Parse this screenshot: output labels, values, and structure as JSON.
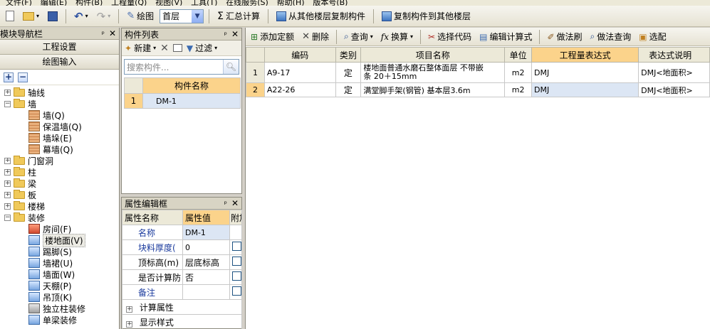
{
  "menubar": {
    "items": [
      "文件(F)",
      "编辑(E)",
      "构件(B)",
      "工程量(Q)",
      "视图(V)",
      "工具(T)",
      "在线服务(S)",
      "帮助(H)",
      "版本号(B)"
    ]
  },
  "toolbar": {
    "draw_label": "绘图",
    "floor_value": "首层",
    "sum_label": "汇总计算",
    "copy_from_label": "从其他楼层复制构件",
    "copy_to_label": "复制构件到其他楼层"
  },
  "nav": {
    "title": "模块导航栏",
    "btn_project": "工程设置",
    "btn_draw": "绘图输入",
    "tree": {
      "axis": "轴线",
      "wall": "墙",
      "wall_items": [
        "墙(Q)",
        "保温墙(Q)",
        "墙垛(E)",
        "幕墙(Q)"
      ],
      "doorwin": "门窗洞",
      "column": "柱",
      "beam": "梁",
      "slab": "板",
      "stairs": "楼梯",
      "decor": "装修",
      "decor_items": [
        "房间(F)",
        "楼地面(V)",
        "踢脚(S)",
        "墙裙(U)",
        "墙面(W)",
        "天棚(P)",
        "吊顶(K)",
        "独立柱装修",
        "单梁装修"
      ]
    }
  },
  "component_list": {
    "title": "构件列表",
    "new_label": "新建",
    "filter_label": "过滤",
    "search_placeholder": "搜索构件...",
    "col_name": "构件名称",
    "rows": [
      {
        "num": "1",
        "name": "DM-1"
      }
    ]
  },
  "property_panel": {
    "title": "属性编辑框",
    "col_name": "属性名称",
    "col_value": "属性值",
    "col_extra": "附加",
    "rows": [
      {
        "name": "名称",
        "value": "DM-1",
        "has_check": false
      },
      {
        "name": "块料厚度(",
        "value": "0",
        "has_check": true
      },
      {
        "name": "顶标高(m)",
        "value": "层底标高",
        "has_check": true
      },
      {
        "name": "是否计算防",
        "value": "否",
        "has_check": true
      },
      {
        "name": "备注",
        "value": "",
        "has_check": true
      }
    ],
    "group_calc": "计算属性",
    "group_display": "显示样式"
  },
  "right_toolbar": {
    "add_quota": "添加定额",
    "delete": "删除",
    "query": "查询",
    "convert": "换算",
    "select_code": "选择代码",
    "edit_expr": "编辑计算式",
    "method_brush": "做法刷",
    "method_query": "做法查询",
    "select_match": "选配"
  },
  "quota_table": {
    "headers": {
      "code": "编码",
      "category": "类别",
      "item_name": "项目名称",
      "unit": "单位",
      "qty_expr": "工程量表达式",
      "expr_desc": "表达式说明"
    },
    "rows": [
      {
        "num": "1",
        "code": "A9-17",
        "category": "定",
        "name_line1": "楼地面普通水磨石整体面层 不带嵌",
        "name_line2": "条 20＋15mm",
        "unit": "m2",
        "qty_expr": "DMJ",
        "expr_desc": "DMJ<地面积>"
      },
      {
        "num": "2",
        "code": "A22-26",
        "category": "定",
        "name_line1": "满堂脚手架(钢管) 基本层3.6m",
        "name_line2": "",
        "unit": "m2",
        "qty_expr": "DMJ",
        "expr_desc": "DMJ<地面积>"
      }
    ]
  }
}
